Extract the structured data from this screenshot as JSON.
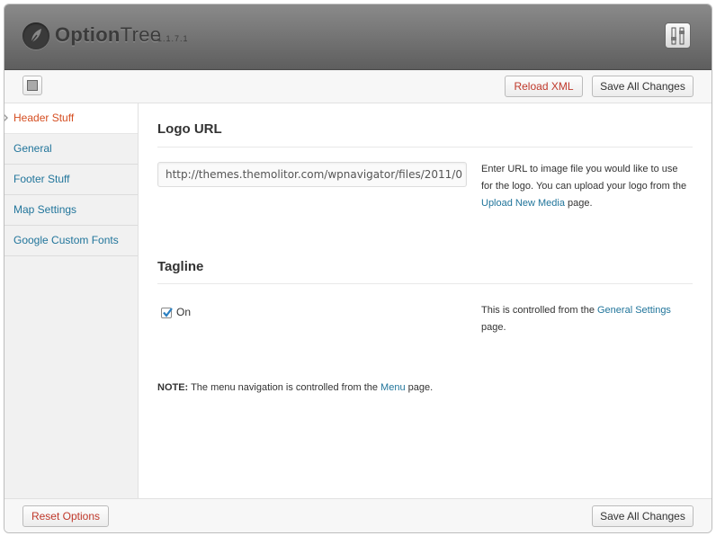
{
  "app": {
    "brand_bold": "Option",
    "brand_light": "Tree",
    "version": "1.1.7.1"
  },
  "toolbar": {
    "reload_label": "Reload XML",
    "save_label": "Save All Changes"
  },
  "sidebar": {
    "items": [
      {
        "label": "Header Stuff",
        "active": true
      },
      {
        "label": "General",
        "active": false
      },
      {
        "label": "Footer Stuff",
        "active": false
      },
      {
        "label": "Map Settings",
        "active": false
      },
      {
        "label": "Google Custom Fonts",
        "active": false
      }
    ]
  },
  "main": {
    "logo_section": {
      "title": "Logo URL",
      "input_value": "http://themes.themolitor.com/wpnavigator/files/2011/0",
      "desc_before": "Enter URL to image file you would like to use for the logo. You can upload your logo from the ",
      "desc_link": "Upload New Media",
      "desc_after": " page."
    },
    "tagline_section": {
      "title": "Tagline",
      "checkbox_label": "On",
      "checked": true,
      "desc_before": "This is controlled from the ",
      "desc_link": "General Settings",
      "desc_after": " page."
    },
    "note": {
      "label": "NOTE:",
      "text_before": " The menu navigation is controlled from the ",
      "link": "Menu",
      "text_after": " page."
    }
  },
  "footer": {
    "reset_label": "Reset Options",
    "save_label": "Save All Changes"
  },
  "colors": {
    "link": "#21759b",
    "active_nav": "#d54e21",
    "danger_button": "#c0392b",
    "header_bg": "#6e6e6e"
  },
  "icons": [
    "leaf-logo-icon",
    "settings-sliders-icon",
    "toggle-layout-icon",
    "checkbox-check-icon",
    "active-caret-icon"
  ]
}
